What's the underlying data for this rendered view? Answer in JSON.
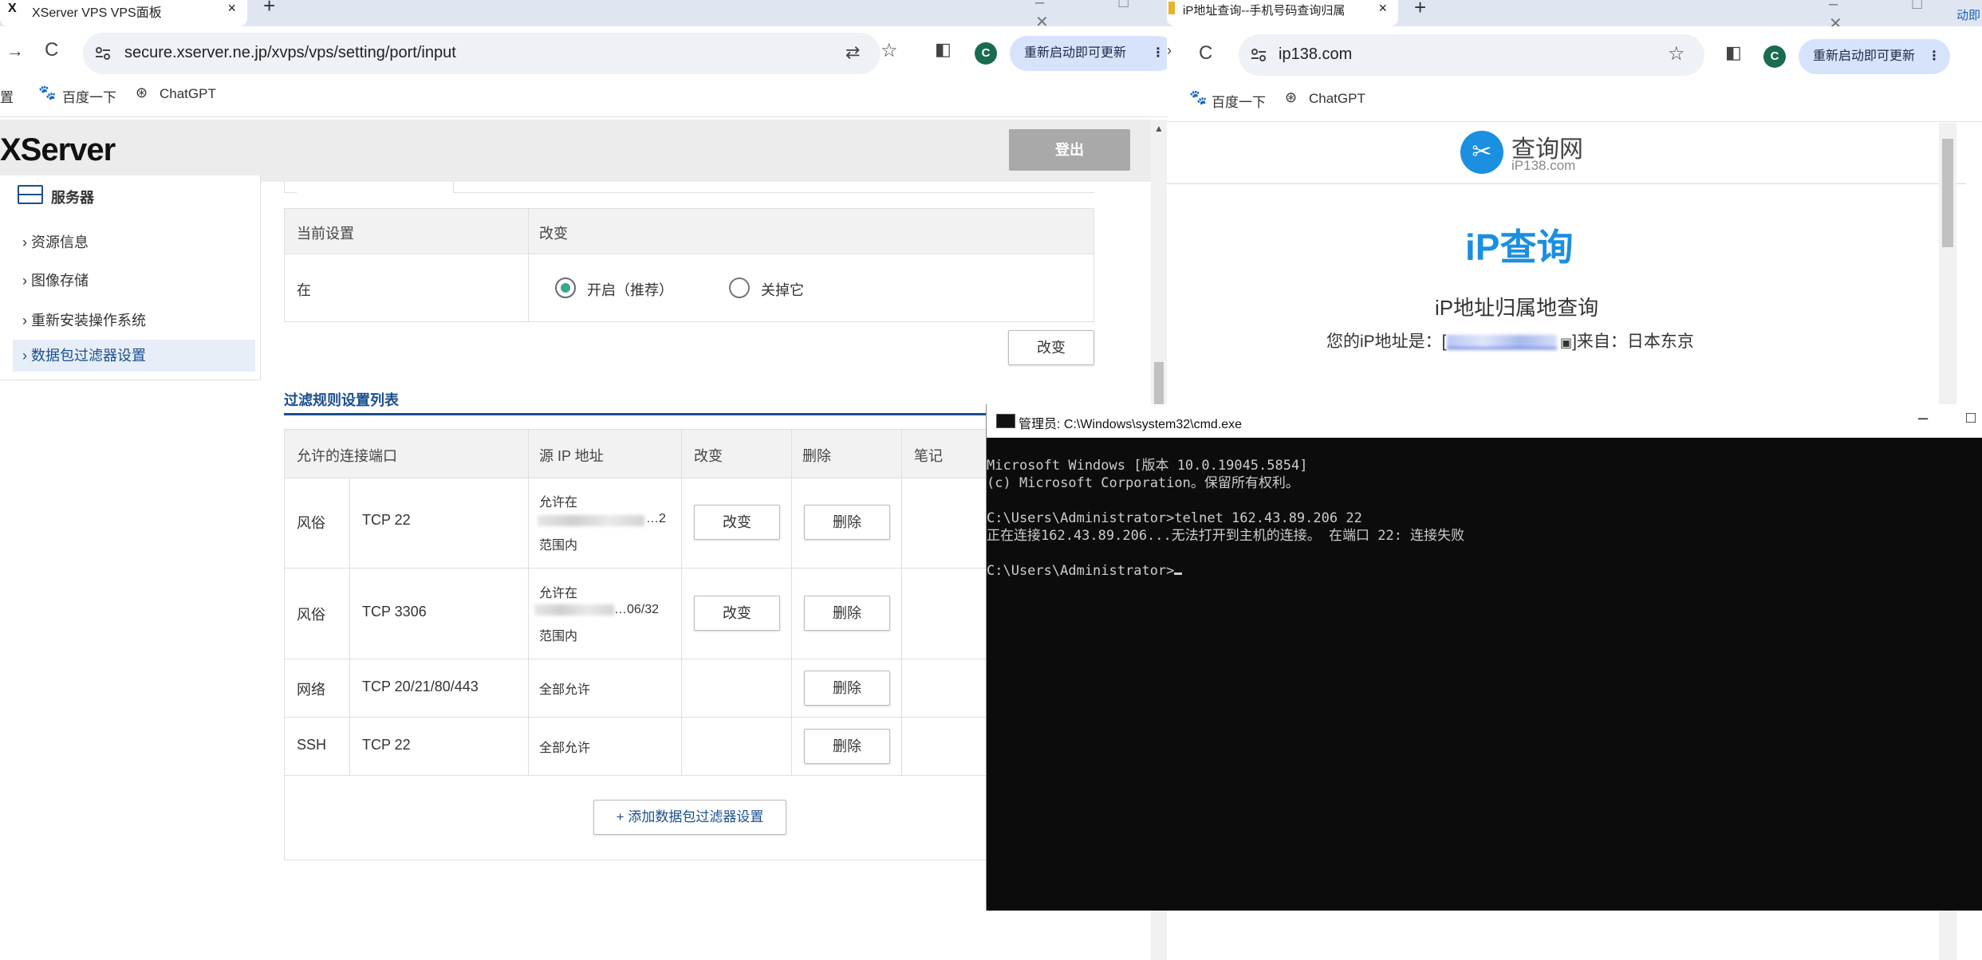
{
  "left_browser": {
    "tab_title": "XServer VPS VPS面板",
    "tab_close": "×",
    "new_tab": "+",
    "url": "secure.xserver.ne.jp/xvps/vps/setting/port/input",
    "update_button": "重新启动即可更新",
    "avatar_letter": "C",
    "bookmarks": [
      "置",
      "百度一下",
      "ChatGPT"
    ],
    "logo": "XServer",
    "logout": "登出",
    "sidebar": {
      "title": "服务器",
      "items": [
        "资源信息",
        "图像存储",
        "重新安装操作系统",
        "数据包过滤器设置"
      ]
    },
    "status_table": {
      "header_current": "当前设置",
      "header_change": "改变",
      "current_value": "在",
      "option_on": "开启（推荐）",
      "option_off": "关掉它",
      "change_button": "改变"
    },
    "rules_title": "过滤规则设置列表",
    "rules_headers": [
      "允许的连接端口",
      "源 IP 地址",
      "改变",
      "删除",
      "笔记"
    ],
    "rules": [
      {
        "name": "风俗",
        "port": "TCP 22",
        "ip_line1": "允许在",
        "ip_line2": "…2",
        "ip_line3": "范围内",
        "edit": "改变",
        "delete": "删除"
      },
      {
        "name": "风俗",
        "port": "TCP 3306",
        "ip_line1": "允许在",
        "ip_line2": "…06/32",
        "ip_line3": "范围内",
        "edit": "改变",
        "delete": "删除"
      },
      {
        "name": "网络",
        "port": "TCP 20/21/80/443",
        "ip_line1": "全部允许",
        "delete": "删除"
      },
      {
        "name": "SSH",
        "port": "TCP 22",
        "ip_line1": "全部允许",
        "delete": "删除"
      }
    ],
    "add_button": "+ 添加数据包过滤器设置"
  },
  "right_browser": {
    "tab_title": "iP地址查询--手机号码查询归属",
    "tab_close": "×",
    "new_tab": "+",
    "url": "ip138.com",
    "update_button": "重新启动即可更新",
    "avatar_letter": "C",
    "bookmarks": [
      "百度一下",
      "ChatGPT"
    ],
    "site_name": "查询网",
    "site_domain": "iP138.com",
    "heading": "iP查询",
    "subheading": "iP地址归属地查询",
    "your_ip_prefix": "您的iP地址是：[",
    "your_ip_suffix": "]来自：日本东京",
    "edge_text": "动即"
  },
  "cmd": {
    "title": "管理员: C:\\Windows\\system32\\cmd.exe",
    "lines": [
      "Microsoft Windows [版本 10.0.19045.5854]",
      "(c) Microsoft Corporation。保留所有权利。",
      "",
      "C:\\Users\\Administrator>telnet 162.43.89.206 22",
      "正在连接162.43.89.206...无法打开到主机的连接。 在端口 22: 连接失败",
      "",
      "C:\\Users\\Administrator>"
    ]
  },
  "colors": {
    "accent_blue": "#1a4f8e",
    "radio_green": "#3aa890",
    "ip_blue": "#1b8fe0"
  }
}
